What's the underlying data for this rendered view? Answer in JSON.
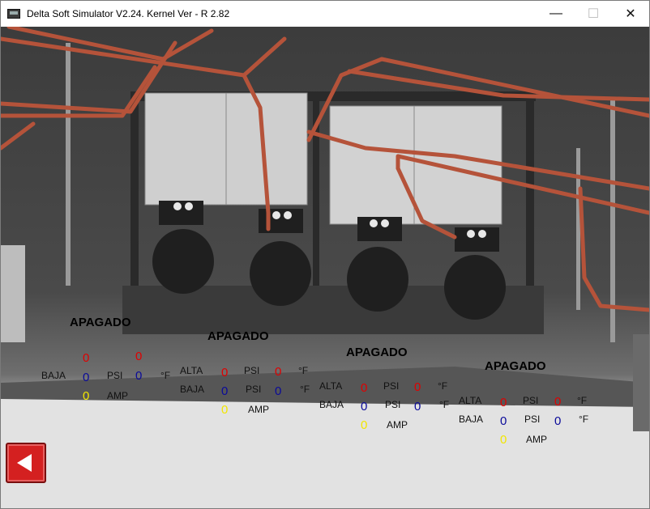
{
  "window": {
    "title": "Delta Soft Simulator V2.24. Kernel Ver - R 2.82",
    "minimize_label": "—",
    "maximize_label": "☐",
    "close_label": "✕"
  },
  "units": {
    "alta": "ALTA",
    "baja": "BAJA",
    "psi": "PSI",
    "fahrenheit": "°F",
    "amp": "AMP"
  },
  "compressors": [
    {
      "status": "APAGADO",
      "alta_psi": "0",
      "alta_temp": "0",
      "baja_psi": "0",
      "baja_temp": "0",
      "amp": "0"
    },
    {
      "status": "APAGADO",
      "alta_psi": "0",
      "alta_temp": "0",
      "baja_psi": "0",
      "baja_temp": "0",
      "amp": "0"
    },
    {
      "status": "APAGADO",
      "alta_psi": "0",
      "alta_temp": "0",
      "baja_psi": "0",
      "baja_temp": "0",
      "amp": "0"
    },
    {
      "status": "APAGADO",
      "alta_psi": "0",
      "alta_temp": "0",
      "baja_psi": "0",
      "baja_temp": "0",
      "amp": "0"
    }
  ],
  "colors": {
    "alta_value": "#e00000",
    "baja_value": "#0a0a9a",
    "amp_value": "#f2e600",
    "back_button": "#d42020",
    "copper_pipe": "#b5533a"
  }
}
